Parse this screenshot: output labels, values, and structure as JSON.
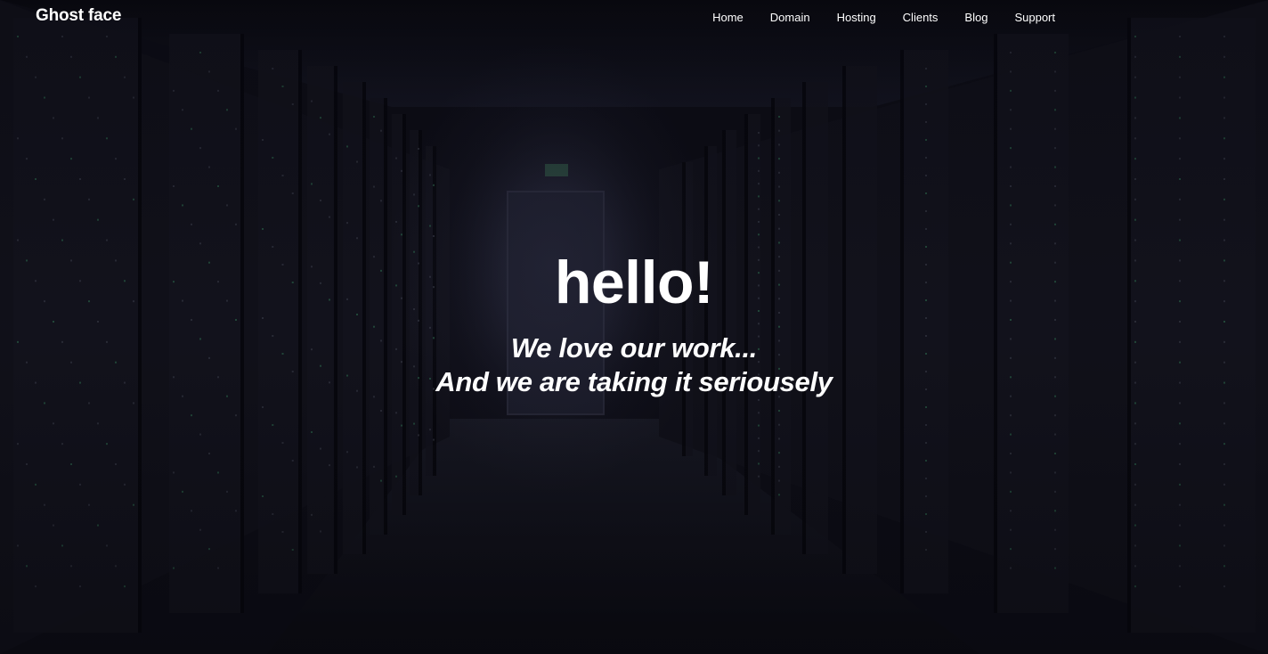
{
  "navbar": {
    "brand": "Ghost face",
    "links": [
      "Home",
      "Domain",
      "Hosting",
      "Clients",
      "Blog",
      "Support"
    ]
  },
  "hero": {
    "headline": "hello!",
    "tagline_line1": "We love our work...",
    "tagline_line2": "And we are taking it seriousely",
    "background": "server-room-corridor-image"
  },
  "colors": {
    "text": "#ffffff",
    "background": "#0d0d16",
    "rack": "#15151f",
    "led_green": "#2e6b4f",
    "led_dim": "#3a3d4a"
  }
}
